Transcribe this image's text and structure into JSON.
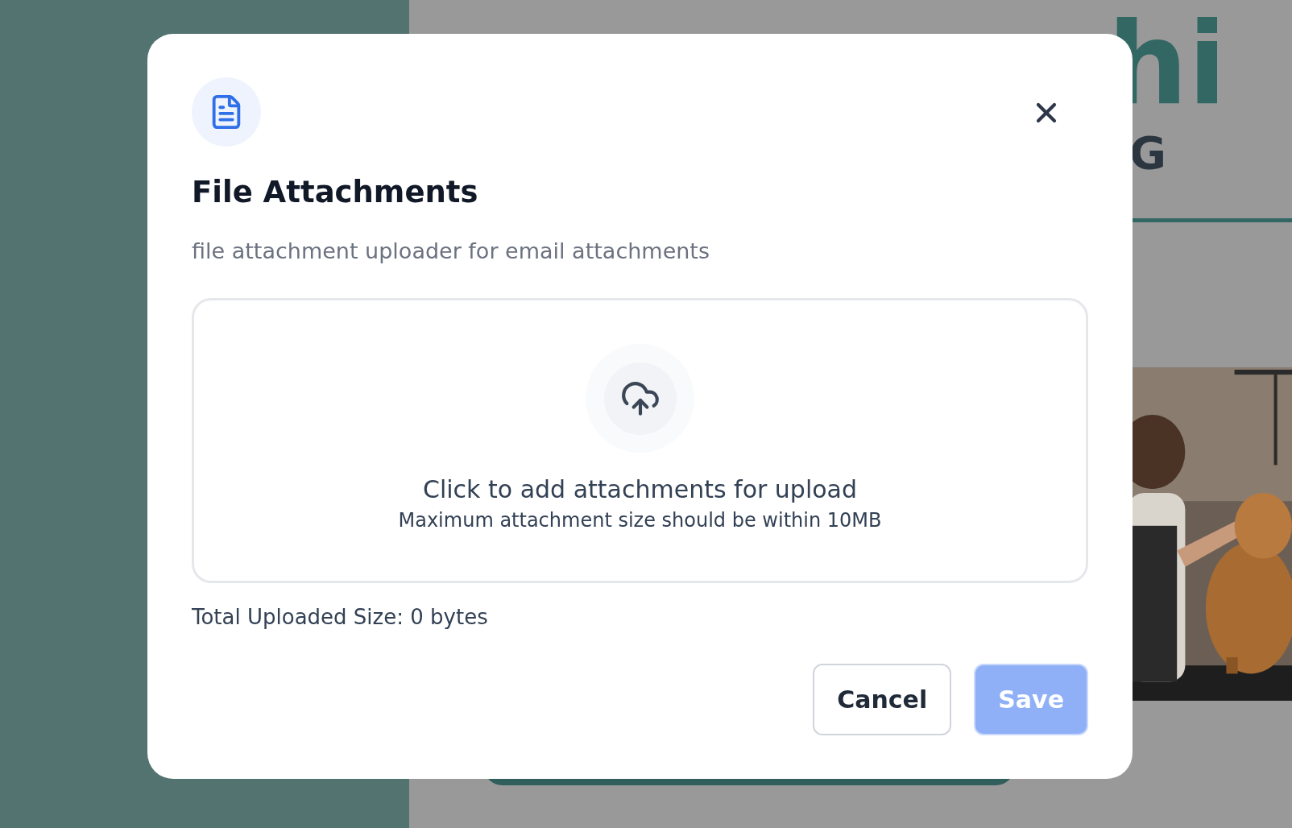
{
  "background": {
    "heading_fragment": "hi",
    "subheading_fragment": "G"
  },
  "dialog": {
    "title": "File Attachments",
    "description": "file attachment uploader for email attachments",
    "dropzone": {
      "prompt": "Click to add attachments for upload",
      "hint": "Maximum attachment size should be within 10MB"
    },
    "total": "Total Uploaded Size: 0 bytes",
    "buttons": [
      {
        "label": "Cancel",
        "kind": "secondary",
        "disabled": false
      },
      {
        "label": "Save",
        "kind": "primary",
        "disabled": true
      }
    ]
  }
}
